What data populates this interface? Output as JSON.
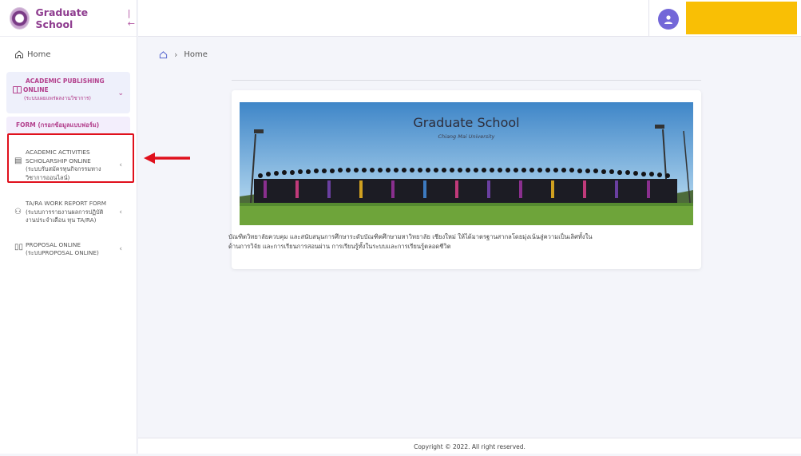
{
  "brand": {
    "title": "Graduate School",
    "toggle_icon": "collapse-sidebar-icon"
  },
  "sidebar": {
    "home_label": "Home",
    "publishing": {
      "title_line1": "ACADEMIC PUBLISHING",
      "title_line2": "ONLINE",
      "subtitle": "(ระบบเผยแพร่ผลงานวิชาการ)"
    },
    "form_label": "FORM (กรอกข้อมูลแบบฟอร์ม)",
    "items": [
      {
        "line1": "ACADEMIC ACTIVITIES",
        "line2": "SCHOLARSHIP ONLINE",
        "line3": "(ระบบรับสมัครทุนกิจกรรมทาง",
        "line4": "วิชาการออนไลน์)"
      },
      {
        "line1": "TA/RA WORK REPORT FORM",
        "line2": "(ระบบการรายงานผลการปฏิบัติ",
        "line3": "งานประจำเดือน ทุน TA/RA)"
      },
      {
        "line1": "PROPOSAL ONLINE",
        "line2": "(ระบบPROPOSAL ONLINE)"
      }
    ]
  },
  "breadcrumb": {
    "current": "Home"
  },
  "banner": {
    "title": "Graduate School",
    "subtitle": "Chiang Mai University"
  },
  "content": {
    "paragraph_line1": "บัณฑิตวิทยาลัยควบคุม และสนับสนุนการศึกษาระดับบัณฑิตศึกษามหาวิทยาลัย เชียงใหม่ ให้ได้มาตรฐานสากลโดยมุ่งเน้นสู่ความเป็นเลิศทั้งใน",
    "paragraph_line2": "ด้านการวิจัย และการเรียนการสอนผ่าน การเรียนรู้ทั้งในระบบและการเรียนรู้ตลอดชีวิต"
  },
  "footer": {
    "text": "Copyright © 2022. All right reserved."
  },
  "colors": {
    "accent": "#b3408d",
    "avatar": "#7367d8",
    "highlight": "#e0101c",
    "yellow": "#f9bf05"
  }
}
